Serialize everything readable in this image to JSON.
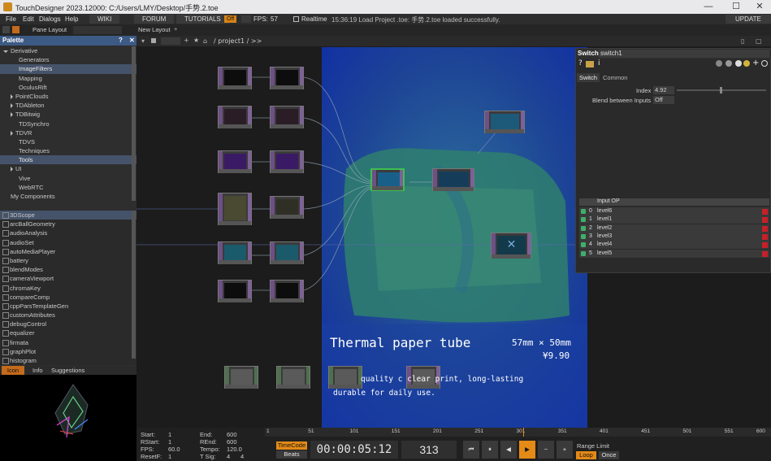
{
  "window": {
    "title": "TouchDesigner 2023.12000: C:/Users/LMY/Desktop/手势.2.toe",
    "minimize": "—",
    "maximize": "☐",
    "close": "✕"
  },
  "menubar": {
    "items": [
      "File",
      "Edit",
      "Dialogs",
      "Help"
    ],
    "wiki": "WIKI",
    "forum": "FORUM",
    "tutorials": "TUTORIALS",
    "off": "Off",
    "fps_label": "FPS:",
    "fps_value": "57",
    "realtime": "Realtime",
    "status": "15:36:19 Load Project .toe: 手势.2.toe loaded successfully.",
    "update": "UPDATE"
  },
  "toolbar": {
    "pane_layout": "Pane Layout",
    "new_layout": "New Layout",
    "path": "/ project1 / >>"
  },
  "palette": {
    "title": "Palette",
    "help": "?",
    "close": "✕",
    "tree": [
      {
        "label": "Derivative",
        "indent": 0,
        "arrow": "down"
      },
      {
        "label": "Generators",
        "indent": 2,
        "arrow": "none"
      },
      {
        "label": "ImageFilters",
        "indent": 2,
        "arrow": "none",
        "selected": true
      },
      {
        "label": "Mapping",
        "indent": 2,
        "arrow": "none"
      },
      {
        "label": "OculusRift",
        "indent": 2,
        "arrow": "none"
      },
      {
        "label": "PointClouds",
        "indent": 1,
        "arrow": "right"
      },
      {
        "label": "TDAbleton",
        "indent": 1,
        "arrow": "right"
      },
      {
        "label": "TDBitwig",
        "indent": 1,
        "arrow": "right"
      },
      {
        "label": "TDSynchro",
        "indent": 2,
        "arrow": "none"
      },
      {
        "label": "TDVR",
        "indent": 1,
        "arrow": "right"
      },
      {
        "label": "TDVS",
        "indent": 2,
        "arrow": "none"
      },
      {
        "label": "Techniques",
        "indent": 2,
        "arrow": "none"
      },
      {
        "label": "Tools",
        "indent": 2,
        "arrow": "none",
        "selected": true
      },
      {
        "label": "UI",
        "indent": 1,
        "arrow": "right"
      },
      {
        "label": "Vive",
        "indent": 2,
        "arrow": "none"
      },
      {
        "label": "WebRTC",
        "indent": 2,
        "arrow": "none"
      },
      {
        "label": "My Components",
        "indent": 1,
        "arrow": "none"
      }
    ],
    "components": [
      "3DScope",
      "arcBallGeometry",
      "audioAnalysis",
      "audioSet",
      "autoMediaPlayer",
      "battery",
      "blendModes",
      "cameraViewport",
      "chromaKey",
      "compareComp",
      "cppParsTemplateGen",
      "customAttributes",
      "debugControl",
      "equalizer",
      "firmata",
      "graphPlot",
      "histogram"
    ]
  },
  "iconpanel": {
    "tabs": [
      "Icon",
      "Info",
      "Suggestions"
    ]
  },
  "params": {
    "op_type": "Switch",
    "op_name": "switch1",
    "tabs": [
      "Switch",
      "Common"
    ],
    "index_label": "Index",
    "index_value": "4.92",
    "blend_label": "Blend between Inputs",
    "blend_value": "Off",
    "input_header": "Input OP",
    "inputs": [
      {
        "num": "0",
        "name": "level6"
      },
      {
        "num": "1",
        "name": "level1"
      },
      {
        "num": "2",
        "name": "level2"
      },
      {
        "num": "3",
        "name": "level3"
      },
      {
        "num": "4",
        "name": "level4"
      },
      {
        "num": "5",
        "name": "level5"
      }
    ]
  },
  "overlay_text": {
    "heading": "Thermal paper tube",
    "size": "57mm × 50mm",
    "price": "¥9.90",
    "line1": "quality c   clear print, long-lasting",
    "line2": "durable for daily use."
  },
  "timeline": {
    "start_label": "Start:",
    "start": "1",
    "rstart_label": "RStart:",
    "rstart": "1",
    "fps_label": "FPS:",
    "fps": "60.0",
    "resetf_label": "ResetF:",
    "resetf": "1",
    "end_label": "End:",
    "end": "600",
    "rend_label": "REnd:",
    "rend": "600",
    "tempo_label": "Tempo:",
    "tempo": "120.0",
    "tsig_label": "T Sig:",
    "tsig_a": "4",
    "tsig_b": "4",
    "timecode_btn": "TimeCode",
    "beats_btn": "Beats",
    "timecode": "00:00:05:12",
    "frame": "313",
    "ticks": [
      "1",
      "51",
      "101",
      "151",
      "201",
      "251",
      "301",
      "351",
      "401",
      "451",
      "501",
      "551",
      "600"
    ],
    "range_limit": "Range Limit",
    "loop": "Loop",
    "once": "Once"
  }
}
